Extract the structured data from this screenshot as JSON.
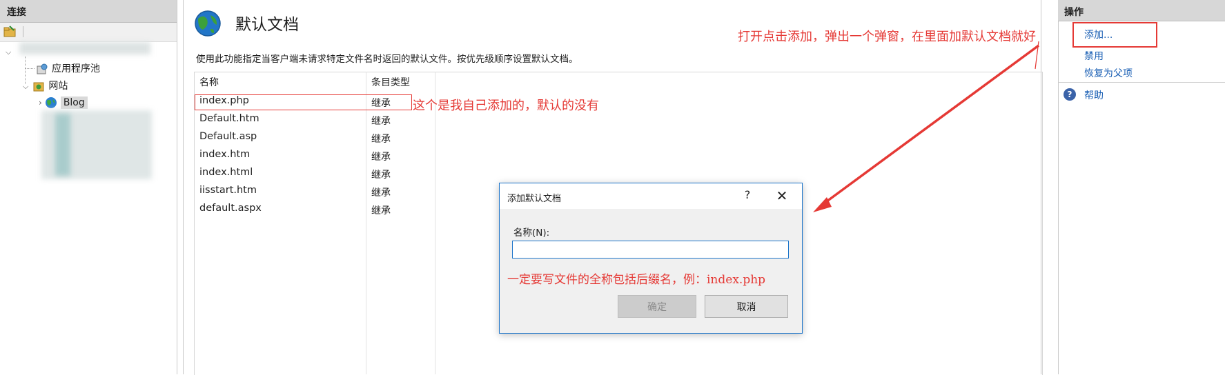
{
  "connections": {
    "header": "连接",
    "tree": {
      "app_pools": "应用程序池",
      "sites": "网站",
      "blog": "Blog"
    }
  },
  "main": {
    "title": "默认文档",
    "description": "使用此功能指定当客户端未请求特定文件名时返回的默认文件。按优先级顺序设置默认文档。",
    "columns": [
      "名称",
      "条目类型"
    ],
    "rows": [
      {
        "name": "index.php",
        "type": "继承"
      },
      {
        "name": "Default.htm",
        "type": "继承"
      },
      {
        "name": "Default.asp",
        "type": "继承"
      },
      {
        "name": "index.htm",
        "type": "继承"
      },
      {
        "name": "index.html",
        "type": "继承"
      },
      {
        "name": "iisstart.htm",
        "type": "继承"
      },
      {
        "name": "default.aspx",
        "type": "继承"
      }
    ]
  },
  "dialog": {
    "title": "添加默认文档",
    "help_symbol": "?",
    "close_symbol": "✕",
    "name_label": "名称(N):",
    "name_value": "",
    "ok_label": "确定",
    "cancel_label": "取消"
  },
  "actions": {
    "header": "操作",
    "add": "添加...",
    "disable": "禁用",
    "revert": "恢复为父项",
    "help": "帮助"
  },
  "annotations": {
    "top_note": "打开点击添加，弹出一个弹窗，在里面加默认文档就好",
    "row_note": "这个是我自己添加的，默认的没有",
    "dialog_note": "一定要写文件的全称包括后缀名，例：index.php",
    "color": "#e53935"
  },
  "icons": {
    "globe": "globe-icon",
    "help": "help-icon",
    "close": "close-icon"
  }
}
